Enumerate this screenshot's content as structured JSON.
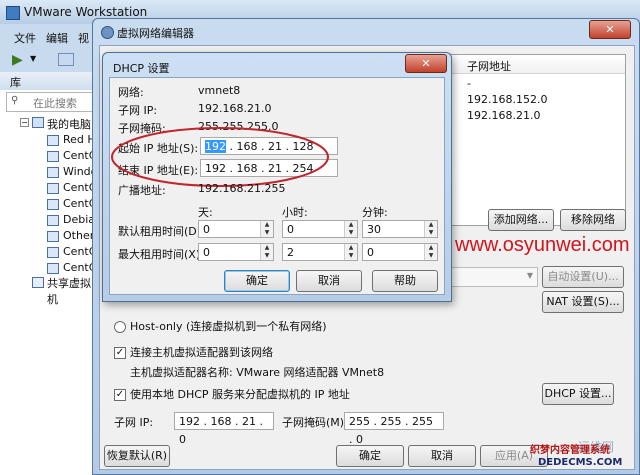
{
  "vmware": {
    "title": "VMware Workstation",
    "menu": [
      "文件",
      "编辑",
      "视"
    ],
    "library_label": "库",
    "search_placeholder": "在此搜索",
    "tree_root": "我的电脑",
    "tree_items": [
      "Red H",
      "CentC",
      "Windo",
      "CentC",
      "CentC",
      "Debia",
      "Other",
      "CentC",
      "CentC"
    ],
    "shared": "共享虚拟机"
  },
  "vne": {
    "title": "虚拟网络编辑器",
    "table_header_col1": "子网地址",
    "table_rows": [
      "-",
      "192.168.152.0",
      "192.168.21.0"
    ],
    "add_network": "添加网络...",
    "remove_network": "移除网络",
    "auto_settings": "自动设置(U)...",
    "nat_settings": "NAT 设置(S)...",
    "hostonly_label": "Host-only (连接虚拟机到一个私有网络)",
    "connect_adapter": "连接主机虚拟适配器到该网络",
    "adapter_name": "主机虚拟适配器名称: VMware 网络适配器 VMnet8",
    "use_dhcp": "使用本地 DHCP 服务来分配虚拟机的 IP 地址",
    "dhcp_settings": "DHCP 设置...",
    "subnet_ip_label": "子网 IP:",
    "subnet_ip_value": "192 . 168 . 21 . 0",
    "subnet_mask_label": "子网掩码(M):",
    "subnet_mask_value": "255 . 255 . 255 . 0",
    "restore_default": "恢复默认(R)",
    "ok": "确定",
    "cancel": "取消",
    "apply": "应用(A)"
  },
  "dhcp": {
    "title": "DHCP 设置",
    "network_label": "网络:",
    "network_value": "vmnet8",
    "subnet_ip_label": "子网 IP:",
    "subnet_ip_value": "192.168.21.0",
    "subnet_mask_label": "子网掩码:",
    "subnet_mask_value": "255.255.255.0",
    "start_ip_label": "起始 IP 地址(S):",
    "start_ip_sel": "192",
    "start_ip_rest": " . 168 . 21 . 128",
    "end_ip_label": "结束 IP 地址(E):",
    "end_ip_value": "192 . 168 . 21 . 254",
    "broadcast_label": "广播地址:",
    "broadcast_value": "192.168.21.255",
    "days": "天:",
    "hours": "小时:",
    "minutes": "分钟:",
    "default_lease_label": "默认租用时间(D):",
    "default_lease": [
      "0",
      "0",
      "30"
    ],
    "max_lease_label": "最大租用时间(X):",
    "max_lease": [
      "0",
      "2",
      "0"
    ],
    "ok": "确定",
    "cancel": "取消",
    "help": "帮助"
  },
  "watermark": {
    "url": "www.osyunwei.com",
    "site_text": "织梦内容管理系统",
    "site_url": "DEDECMS.COM",
    "logo_partial": "运维网"
  },
  "colors": {
    "highlight_ellipse": "#c0262d",
    "watermark_red": "#d4141b",
    "selection": "#3399ff"
  }
}
